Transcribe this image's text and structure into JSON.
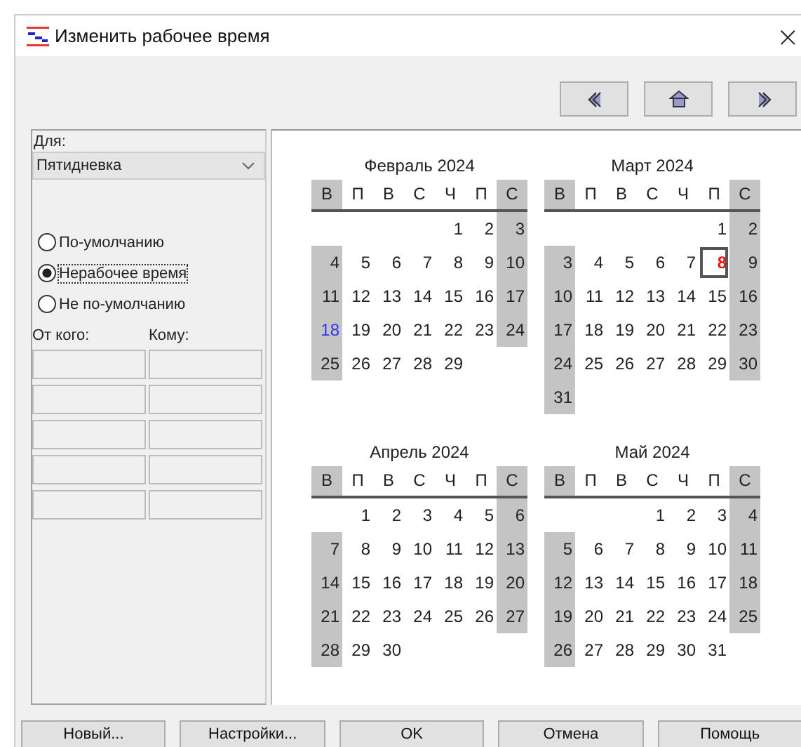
{
  "window": {
    "title": "Изменить рабочее время",
    "close": "×"
  },
  "nav_buttons": [
    {
      "kind": "prev"
    },
    {
      "kind": "home"
    },
    {
      "kind": "next"
    }
  ],
  "calendar_for": {
    "label": "Для:",
    "value": "Пятидневка"
  },
  "day_type": [
    {
      "label": "По-умолчанию",
      "selected": false
    },
    {
      "label": "Нерабочее время",
      "selected": true
    },
    {
      "label": "Не по-умолчанию",
      "selected": false
    }
  ],
  "time_table": {
    "columns": [
      "От кого:",
      "Кому:"
    ]
  },
  "months": [
    {
      "title": "Февраль 2024",
      "weekdays": [
        {
          "label": "В",
          "off": true
        },
        {
          "label": "П",
          "off": false
        },
        {
          "label": "В",
          "off": false
        },
        {
          "label": "С",
          "off": false
        },
        {
          "label": "Ч",
          "off": false
        },
        {
          "label": "П",
          "off": false
        },
        {
          "label": "С",
          "off": true
        }
      ],
      "weeks": [
        {
          "starts_mid_week": true,
          "days": [
            {
              "day": "1",
              "off": false,
              "kind": "plain",
              "selected": false
            },
            {
              "day": "2",
              "off": false,
              "kind": "plain",
              "selected": false
            },
            {
              "day": "3",
              "off": true,
              "kind": "plain",
              "selected": false
            }
          ]
        },
        [
          {
            "day": "4",
            "off": true,
            "kind": "plain",
            "selected": false
          },
          {
            "day": "5",
            "off": false,
            "kind": "plain",
            "selected": false
          },
          {
            "day": "6",
            "off": false,
            "kind": "plain",
            "selected": false
          },
          {
            "day": "7",
            "off": false,
            "kind": "plain",
            "selected": false
          },
          {
            "day": "8",
            "off": false,
            "kind": "plain",
            "selected": false
          },
          {
            "day": "9",
            "off": false,
            "kind": "plain",
            "selected": false
          },
          {
            "day": "10",
            "off": true,
            "kind": "plain",
            "selected": false
          }
        ],
        [
          {
            "day": "11",
            "off": true,
            "kind": "plain",
            "selected": false
          },
          {
            "day": "12",
            "off": false,
            "kind": "plain",
            "selected": false
          },
          {
            "day": "13",
            "off": false,
            "kind": "plain",
            "selected": false
          },
          {
            "day": "14",
            "off": false,
            "kind": "plain",
            "selected": false
          },
          {
            "day": "15",
            "off": false,
            "kind": "plain",
            "selected": false
          },
          {
            "day": "16",
            "off": false,
            "kind": "plain",
            "selected": false
          },
          {
            "day": "17",
            "off": true,
            "kind": "plain",
            "selected": false
          }
        ],
        [
          {
            "day": "18",
            "off": true,
            "kind": "changed",
            "selected": false
          },
          {
            "day": "19",
            "off": false,
            "kind": "plain",
            "selected": false
          },
          {
            "day": "20",
            "off": false,
            "kind": "plain",
            "selected": false
          },
          {
            "day": "21",
            "off": false,
            "kind": "plain",
            "selected": false
          },
          {
            "day": "22",
            "off": false,
            "kind": "plain",
            "selected": false
          },
          {
            "day": "23",
            "off": false,
            "kind": "plain",
            "selected": false
          },
          {
            "day": "24",
            "off": true,
            "kind": "plain",
            "selected": false
          }
        ],
        [
          {
            "day": "25",
            "off": true,
            "kind": "plain",
            "selected": false
          },
          {
            "day": "26",
            "off": false,
            "kind": "plain",
            "selected": false
          },
          {
            "day": "27",
            "off": false,
            "kind": "plain",
            "selected": false
          },
          {
            "day": "28",
            "off": false,
            "kind": "plain",
            "selected": false
          },
          {
            "day": "29",
            "off": false,
            "kind": "plain",
            "selected": false
          }
        ]
      ]
    },
    {
      "title": "Март 2024",
      "weekdays": [
        {
          "label": "В",
          "off": true
        },
        {
          "label": "П",
          "off": false
        },
        {
          "label": "В",
          "off": false
        },
        {
          "label": "С",
          "off": false
        },
        {
          "label": "Ч",
          "off": false
        },
        {
          "label": "П",
          "off": false
        },
        {
          "label": "С",
          "off": true
        }
      ],
      "weeks": [
        {
          "starts_mid_week": true,
          "days": [
            {
              "day": "1",
              "off": false,
              "kind": "plain",
              "selected": false
            },
            {
              "day": "2",
              "off": true,
              "kind": "plain",
              "selected": false
            }
          ]
        },
        [
          {
            "day": "3",
            "off": true,
            "kind": "plain",
            "selected": false
          },
          {
            "day": "4",
            "off": false,
            "kind": "plain",
            "selected": false
          },
          {
            "day": "5",
            "off": false,
            "kind": "plain",
            "selected": false
          },
          {
            "day": "6",
            "off": false,
            "kind": "plain",
            "selected": false
          },
          {
            "day": "7",
            "off": false,
            "kind": "plain",
            "selected": false
          },
          {
            "day": "8",
            "off": false,
            "kind": "holiday",
            "selected": true
          },
          {
            "day": "9",
            "off": true,
            "kind": "plain",
            "selected": false
          }
        ],
        [
          {
            "day": "10",
            "off": true,
            "kind": "plain",
            "selected": false
          },
          {
            "day": "11",
            "off": false,
            "kind": "plain",
            "selected": false
          },
          {
            "day": "12",
            "off": false,
            "kind": "plain",
            "selected": false
          },
          {
            "day": "13",
            "off": false,
            "kind": "plain",
            "selected": false
          },
          {
            "day": "14",
            "off": false,
            "kind": "plain",
            "selected": false
          },
          {
            "day": "15",
            "off": false,
            "kind": "plain",
            "selected": false
          },
          {
            "day": "16",
            "off": true,
            "kind": "plain",
            "selected": false
          }
        ],
        [
          {
            "day": "17",
            "off": true,
            "kind": "plain",
            "selected": false
          },
          {
            "day": "18",
            "off": false,
            "kind": "plain",
            "selected": false
          },
          {
            "day": "19",
            "off": false,
            "kind": "plain",
            "selected": false
          },
          {
            "day": "20",
            "off": false,
            "kind": "plain",
            "selected": false
          },
          {
            "day": "21",
            "off": false,
            "kind": "plain",
            "selected": false
          },
          {
            "day": "22",
            "off": false,
            "kind": "plain",
            "selected": false
          },
          {
            "day": "23",
            "off": true,
            "kind": "plain",
            "selected": false
          }
        ],
        [
          {
            "day": "24",
            "off": true,
            "kind": "plain",
            "selected": false
          },
          {
            "day": "25",
            "off": false,
            "kind": "plain",
            "selected": false
          },
          {
            "day": "26",
            "off": false,
            "kind": "plain",
            "selected": false
          },
          {
            "day": "27",
            "off": false,
            "kind": "plain",
            "selected": false
          },
          {
            "day": "28",
            "off": false,
            "kind": "plain",
            "selected": false
          },
          {
            "day": "29",
            "off": false,
            "kind": "plain",
            "selected": false
          },
          {
            "day": "30",
            "off": true,
            "kind": "plain",
            "selected": false
          }
        ],
        [
          {
            "day": "31",
            "off": true,
            "kind": "plain",
            "selected": false
          }
        ]
      ]
    },
    {
      "title": "Апрель 2024",
      "weekdays": [
        {
          "label": "В",
          "off": true
        },
        {
          "label": "П",
          "off": false
        },
        {
          "label": "В",
          "off": false
        },
        {
          "label": "С",
          "off": false
        },
        {
          "label": "Ч",
          "off": false
        },
        {
          "label": "П",
          "off": false
        },
        {
          "label": "С",
          "off": true
        }
      ],
      "weeks": [
        {
          "starts_mid_week": true,
          "days": [
            {
              "day": "1",
              "off": false,
              "kind": "plain",
              "selected": false
            },
            {
              "day": "2",
              "off": false,
              "kind": "plain",
              "selected": false
            },
            {
              "day": "3",
              "off": false,
              "kind": "plain",
              "selected": false
            },
            {
              "day": "4",
              "off": false,
              "kind": "plain",
              "selected": false
            },
            {
              "day": "5",
              "off": false,
              "kind": "plain",
              "selected": false
            },
            {
              "day": "6",
              "off": true,
              "kind": "plain",
              "selected": false
            }
          ]
        },
        [
          {
            "day": "7",
            "off": true,
            "kind": "plain",
            "selected": false
          },
          {
            "day": "8",
            "off": false,
            "kind": "plain",
            "selected": false
          },
          {
            "day": "9",
            "off": false,
            "kind": "plain",
            "selected": false
          },
          {
            "day": "10",
            "off": false,
            "kind": "plain",
            "selected": false
          },
          {
            "day": "11",
            "off": false,
            "kind": "plain",
            "selected": false
          },
          {
            "day": "12",
            "off": false,
            "kind": "plain",
            "selected": false
          },
          {
            "day": "13",
            "off": true,
            "kind": "plain",
            "selected": false
          }
        ],
        [
          {
            "day": "14",
            "off": true,
            "kind": "plain",
            "selected": false
          },
          {
            "day": "15",
            "off": false,
            "kind": "plain",
            "selected": false
          },
          {
            "day": "16",
            "off": false,
            "kind": "plain",
            "selected": false
          },
          {
            "day": "17",
            "off": false,
            "kind": "plain",
            "selected": false
          },
          {
            "day": "18",
            "off": false,
            "kind": "plain",
            "selected": false
          },
          {
            "day": "19",
            "off": false,
            "kind": "plain",
            "selected": false
          },
          {
            "day": "20",
            "off": true,
            "kind": "plain",
            "selected": false
          }
        ],
        [
          {
            "day": "21",
            "off": true,
            "kind": "plain",
            "selected": false
          },
          {
            "day": "22",
            "off": false,
            "kind": "plain",
            "selected": false
          },
          {
            "day": "23",
            "off": false,
            "kind": "plain",
            "selected": false
          },
          {
            "day": "24",
            "off": false,
            "kind": "plain",
            "selected": false
          },
          {
            "day": "25",
            "off": false,
            "kind": "plain",
            "selected": false
          },
          {
            "day": "26",
            "off": false,
            "kind": "plain",
            "selected": false
          },
          {
            "day": "27",
            "off": true,
            "kind": "plain",
            "selected": false
          }
        ],
        [
          {
            "day": "28",
            "off": true,
            "kind": "plain",
            "selected": false
          },
          {
            "day": "29",
            "off": false,
            "kind": "plain",
            "selected": false
          },
          {
            "day": "30",
            "off": false,
            "kind": "plain",
            "selected": false
          }
        ]
      ]
    },
    {
      "title": "Май 2024",
      "weekdays": [
        {
          "label": "В",
          "off": true
        },
        {
          "label": "П",
          "off": false
        },
        {
          "label": "В",
          "off": false
        },
        {
          "label": "С",
          "off": false
        },
        {
          "label": "Ч",
          "off": false
        },
        {
          "label": "П",
          "off": false
        },
        {
          "label": "С",
          "off": true
        }
      ],
      "weeks": [
        {
          "starts_mid_week": true,
          "days": [
            {
              "day": "1",
              "off": false,
              "kind": "plain",
              "selected": false
            },
            {
              "day": "2",
              "off": false,
              "kind": "plain",
              "selected": false
            },
            {
              "day": "3",
              "off": false,
              "kind": "plain",
              "selected": false
            },
            {
              "day": "4",
              "off": true,
              "kind": "plain",
              "selected": false
            }
          ]
        },
        [
          {
            "day": "5",
            "off": true,
            "kind": "plain",
            "selected": false
          },
          {
            "day": "6",
            "off": false,
            "kind": "plain",
            "selected": false
          },
          {
            "day": "7",
            "off": false,
            "kind": "plain",
            "selected": false
          },
          {
            "day": "8",
            "off": false,
            "kind": "plain",
            "selected": false
          },
          {
            "day": "9",
            "off": false,
            "kind": "plain",
            "selected": false
          },
          {
            "day": "10",
            "off": false,
            "kind": "plain",
            "selected": false
          },
          {
            "day": "11",
            "off": true,
            "kind": "plain",
            "selected": false
          }
        ],
        [
          {
            "day": "12",
            "off": true,
            "kind": "plain",
            "selected": false
          },
          {
            "day": "13",
            "off": false,
            "kind": "plain",
            "selected": false
          },
          {
            "day": "14",
            "off": false,
            "kind": "plain",
            "selected": false
          },
          {
            "day": "15",
            "off": false,
            "kind": "plain",
            "selected": false
          },
          {
            "day": "16",
            "off": false,
            "kind": "plain",
            "selected": false
          },
          {
            "day": "17",
            "off": false,
            "kind": "plain",
            "selected": false
          },
          {
            "day": "18",
            "off": true,
            "kind": "plain",
            "selected": false
          }
        ],
        [
          {
            "day": "19",
            "off": true,
            "kind": "plain",
            "selected": false
          },
          {
            "day": "20",
            "off": false,
            "kind": "plain",
            "selected": false
          },
          {
            "day": "21",
            "off": false,
            "kind": "plain",
            "selected": false
          },
          {
            "day": "22",
            "off": false,
            "kind": "plain",
            "selected": false
          },
          {
            "day": "23",
            "off": false,
            "kind": "plain",
            "selected": false
          },
          {
            "day": "24",
            "off": false,
            "kind": "plain",
            "selected": false
          },
          {
            "day": "25",
            "off": true,
            "kind": "plain",
            "selected": false
          }
        ],
        [
          {
            "day": "26",
            "off": true,
            "kind": "plain",
            "selected": false
          },
          {
            "day": "27",
            "off": false,
            "kind": "plain",
            "selected": false
          },
          {
            "day": "28",
            "off": false,
            "kind": "plain",
            "selected": false
          },
          {
            "day": "29",
            "off": false,
            "kind": "plain",
            "selected": false
          },
          {
            "day": "30",
            "off": false,
            "kind": "plain",
            "selected": false
          },
          {
            "day": "31",
            "off": false,
            "kind": "plain",
            "selected": false
          }
        ]
      ]
    }
  ],
  "buttons": [
    "Новый...",
    "Настройки...",
    "OK",
    "Отмена",
    "Помощь"
  ]
}
